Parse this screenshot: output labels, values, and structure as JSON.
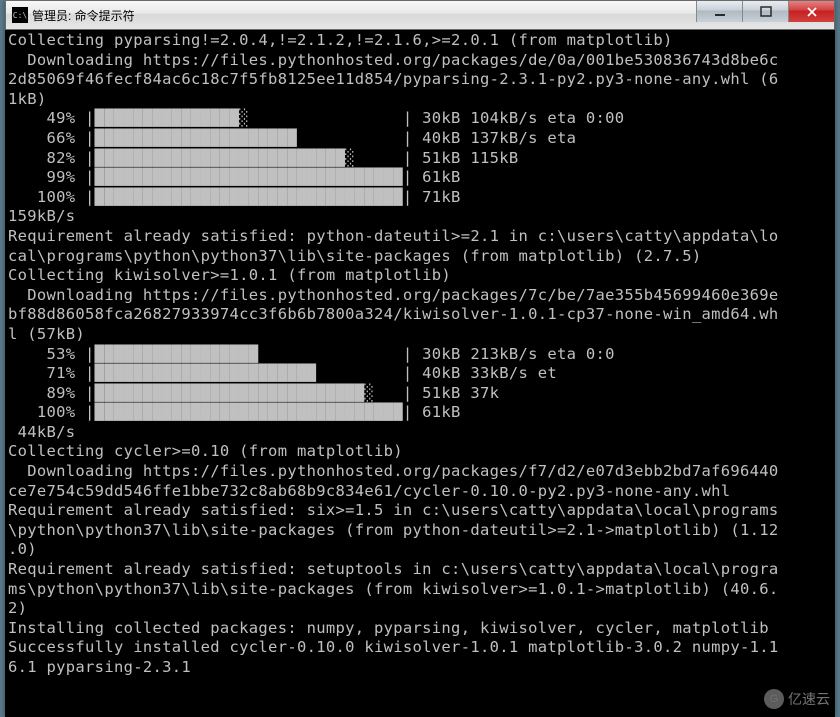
{
  "window": {
    "title_icon_text": "C:\\",
    "title": "管理员: 命令提示符"
  },
  "watermark": {
    "icon_glyph": "G",
    "text": "亿速云"
  },
  "progress_chars": {
    "full": "█",
    "pipe": "|",
    "light": "░"
  },
  "terminal_lines": [
    "Collecting pyparsing!=2.0.4,!=2.1.2,!=2.1.6,>=2.0.1 (from matplotlib)",
    "  Downloading https://files.pythonhosted.org/packages/de/0a/001be530836743d8be6c",
    "2d85069f46fecf84ac6c18c7f5fb8125ee11d854/pyparsing-2.3.1-py2.py3-none-any.whl (6",
    "1kB)",
    "    49% |███████████████░                | 30kB 104kB/s eta 0:00",
    "    66% |█████████████████████           | 40kB 137kB/s eta",
    "    82% |██████████████████████████░     | 51kB 115kB",
    "    99% |████████████████████████████████| 61kB",
    "   100% |████████████████████████████████| 71kB",
    "159kB/s",
    "Requirement already satisfied: python-dateutil>=2.1 in c:\\users\\catty\\appdata\\lo",
    "cal\\programs\\python\\python37\\lib\\site-packages (from matplotlib) (2.7.5)",
    "Collecting kiwisolver>=1.0.1 (from matplotlib)",
    "  Downloading https://files.pythonhosted.org/packages/7c/be/7ae355b45699460e369e",
    "bf88d86058fca26827933974cc3f6b6b7800a324/kiwisolver-1.0.1-cp37-none-win_amd64.wh",
    "l (57kB)",
    "    53% |█████████████████               | 30kB 213kB/s eta 0:0",
    "    71% |███████████████████████         | 40kB 33kB/s et",
    "    89% |████████████████████████████░   | 51kB 37k",
    "   100% |████████████████████████████████| 61kB",
    " 44kB/s",
    "Collecting cycler>=0.10 (from matplotlib)",
    "  Downloading https://files.pythonhosted.org/packages/f7/d2/e07d3ebb2bd7af696440",
    "ce7e754c59dd546ffe1bbe732c8ab68b9c834e61/cycler-0.10.0-py2.py3-none-any.whl",
    "Requirement already satisfied: six>=1.5 in c:\\users\\catty\\appdata\\local\\programs",
    "\\python\\python37\\lib\\site-packages (from python-dateutil>=2.1->matplotlib) (1.12",
    ".0)",
    "Requirement already satisfied: setuptools in c:\\users\\catty\\appdata\\local\\progra",
    "ms\\python\\python37\\lib\\site-packages (from kiwisolver>=1.0.1->matplotlib) (40.6.",
    "2)",
    "Installing collected packages: numpy, pyparsing, kiwisolver, cycler, matplotlib",
    "Successfully installed cycler-0.10.0 kiwisolver-1.0.1 matplotlib-3.0.2 numpy-1.1",
    "6.1 pyparsing-2.3.1"
  ]
}
